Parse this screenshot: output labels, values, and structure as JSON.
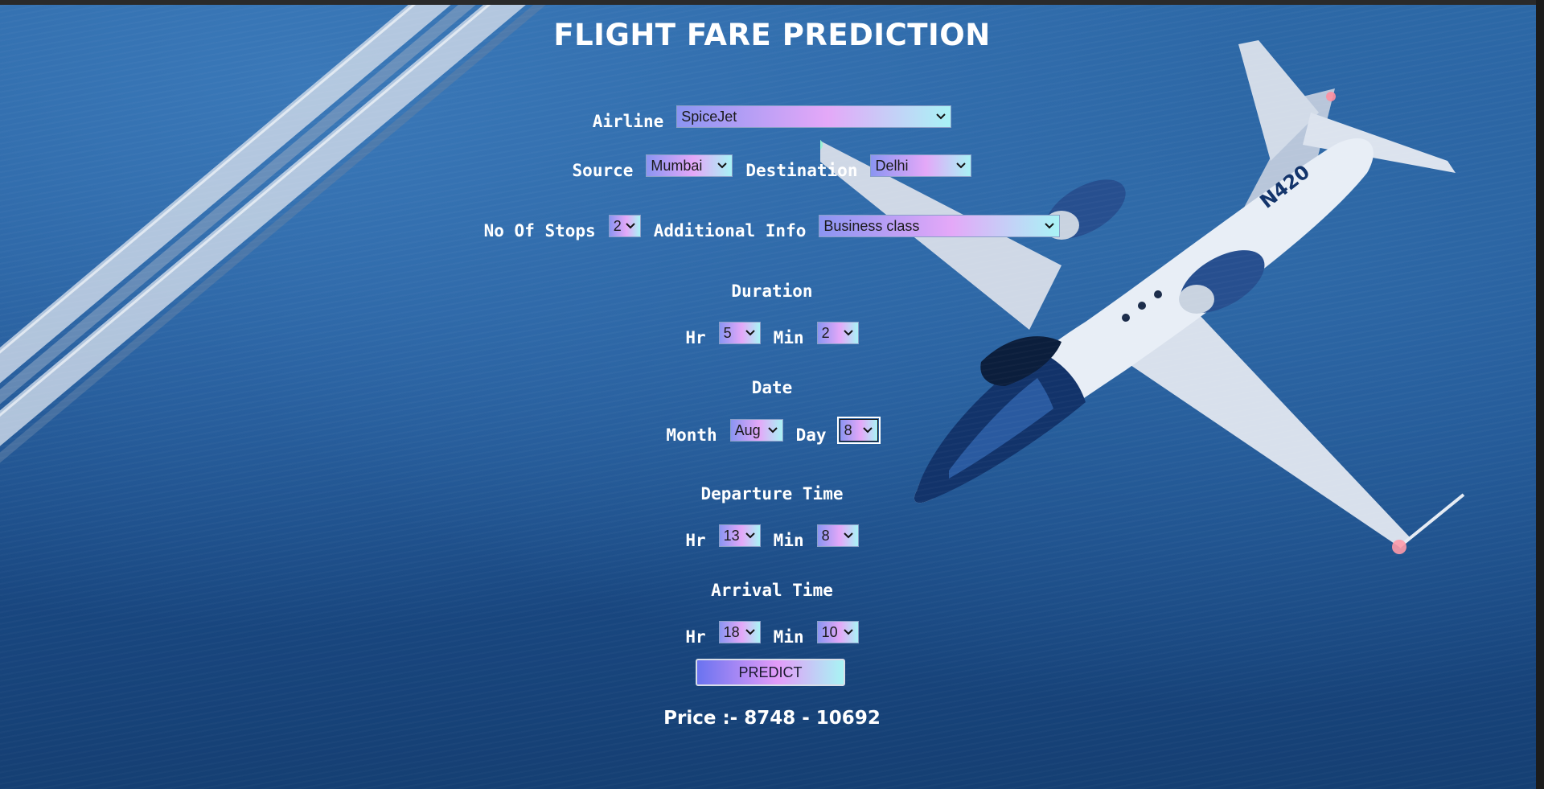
{
  "page": {
    "title": "FLIGHT FARE PREDICTION"
  },
  "form": {
    "airline": {
      "label": "Airline",
      "value": "SpiceJet"
    },
    "source": {
      "label": "Source",
      "value": "Mumbai"
    },
    "destination": {
      "label": "Destination",
      "value": "Delhi"
    },
    "stops": {
      "label": "No Of Stops",
      "value": "2"
    },
    "additional_info": {
      "label": "Additional Info",
      "value": "Business class"
    },
    "duration": {
      "heading": "Duration",
      "hr_label": "Hr",
      "hr_value": "5",
      "min_label": "Min",
      "min_value": "2"
    },
    "date": {
      "heading": "Date",
      "month_label": "Month",
      "month_value": "Aug",
      "day_label": "Day",
      "day_value": "8"
    },
    "departure": {
      "heading": "Departure Time",
      "hr_label": "Hr",
      "hr_value": "13",
      "min_label": "Min",
      "min_value": "8"
    },
    "arrival": {
      "heading": "Arrival Time",
      "hr_label": "Hr",
      "hr_value": "18",
      "min_label": "Min",
      "min_value": "10"
    },
    "predict_label": "PREDICT"
  },
  "result": {
    "price_text": "Price :- 8748 - 10692"
  },
  "icons": {
    "select_arrow": "chevron-down-icon"
  },
  "colors": {
    "background": "#1f4f86",
    "select_gradient_start": "#8b95f2",
    "select_gradient_mid": "#e4a8f8",
    "select_gradient_end": "#a9f3f6",
    "text": "#ffffff"
  }
}
